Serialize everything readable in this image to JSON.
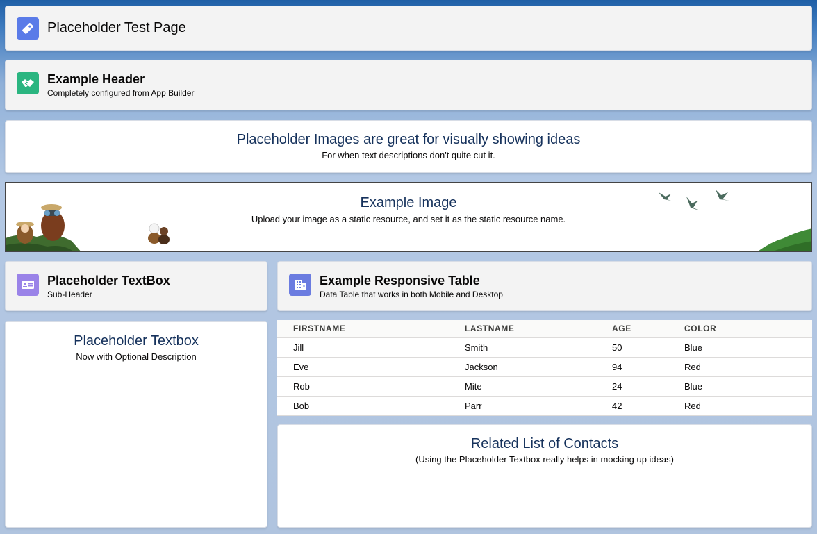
{
  "page_header": {
    "title": "Placeholder Test Page",
    "icon": "tag-icon",
    "icon_color": "#5a7be8"
  },
  "example_header": {
    "title": "Example Header",
    "subtitle": "Completely configured from App Builder",
    "icon": "handshake-icon",
    "icon_color": "#2ab580"
  },
  "images_section": {
    "title": "Placeholder Images are great for visually showing ideas",
    "description": "For when text descriptions don't quite cut it."
  },
  "example_image": {
    "title": "Example Image",
    "description": "Upload your image as a static resource, and set it as the static resource name."
  },
  "textbox_header": {
    "title": "Placeholder TextBox",
    "subtitle": "Sub-Header",
    "icon": "contact-card-icon",
    "icon_color": "#9a83e8"
  },
  "table_header": {
    "title": "Example Responsive Table",
    "subtitle": "Data Table that works in both Mobile and Desktop",
    "icon": "building-icon",
    "icon_color": "#6b7ce0"
  },
  "textbox_body": {
    "title": "Placeholder Textbox",
    "description": "Now with Optional Description"
  },
  "table": {
    "columns": [
      "FIRSTNAME",
      "LASTNAME",
      "AGE",
      "COLOR"
    ],
    "rows": [
      [
        "Jill",
        "Smith",
        "50",
        "Blue"
      ],
      [
        "Eve",
        "Jackson",
        "94",
        "Red"
      ],
      [
        "Rob",
        "Mite",
        "24",
        "Blue"
      ],
      [
        "Bob",
        "Parr",
        "42",
        "Red"
      ]
    ]
  },
  "related_list": {
    "title": "Related List of Contacts",
    "description": "(Using the Placeholder Textbox really helps in mocking up ideas)"
  }
}
